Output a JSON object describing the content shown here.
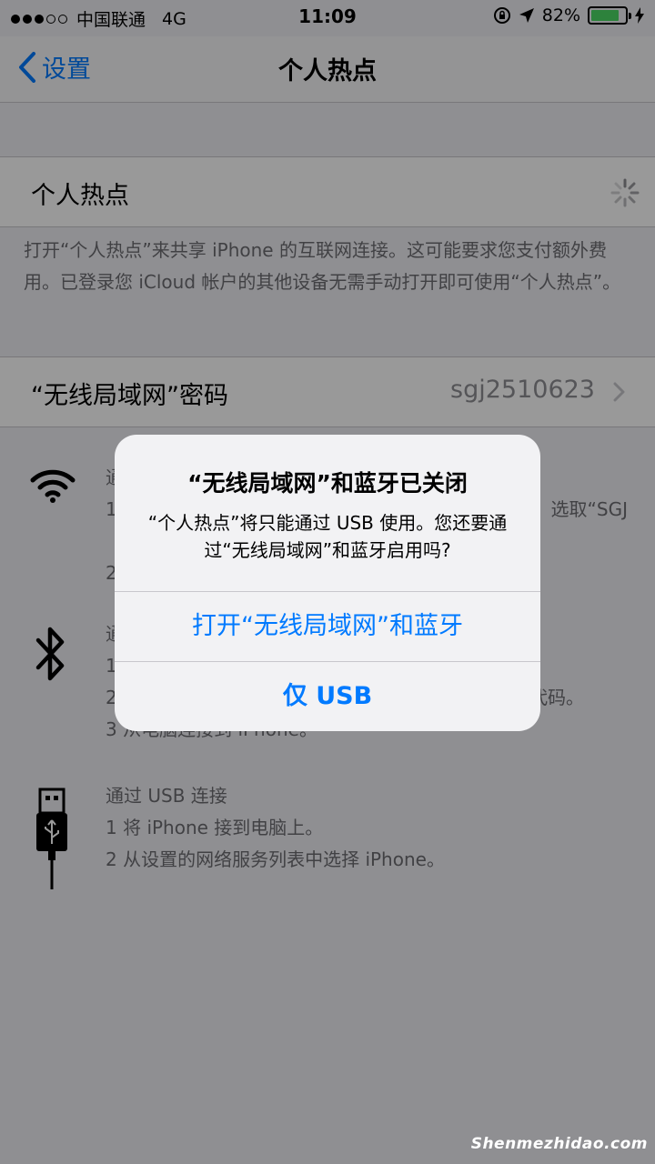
{
  "status_bar": {
    "carrier": "中国联通",
    "network": "4G",
    "time": "11:09",
    "battery_percent": "82%",
    "battery_level": 0.82
  },
  "nav": {
    "back_label": "设置",
    "title": "个人热点"
  },
  "hotspot": {
    "label": "个人热点",
    "description": "打开“个人热点”来共享 iPhone 的互联网连接。这可能要求您支付额外费用。已登录您 iCloud 帐户的其他设备无需手动打开即可使用“个人热点”。"
  },
  "wifi_password": {
    "label": "“无线局域网”密码",
    "value": "sgj2510623"
  },
  "instructions": {
    "wifi": {
      "line1": "通",
      "line2": "1",
      "line2_tail": "选取“SGJ",
      "line3": "2"
    },
    "bluetooth": {
      "line1": "通",
      "line2": "1",
      "line3": "2",
      "line3_tail": "代码。",
      "line4": "3 从电脑连接到 iPhone。"
    },
    "usb": {
      "line1": "通过 USB 连接",
      "line2": "1 将 iPhone 接到电脑上。",
      "line3": "2 从设置的网络服务列表中选择 iPhone。"
    }
  },
  "alert": {
    "title": "“无线局域网”和蓝牙已关闭",
    "message": "“个人热点”将只能通过 USB 使用。您还要通过“无线局域网”和蓝牙启用吗?",
    "button_enable": "打开“无线局域网”和蓝牙",
    "button_usb_only": "仅 USB"
  },
  "watermark": "Shenmezhidao.com",
  "colors": {
    "accent": "#007aff",
    "battery": "#4cd964"
  }
}
